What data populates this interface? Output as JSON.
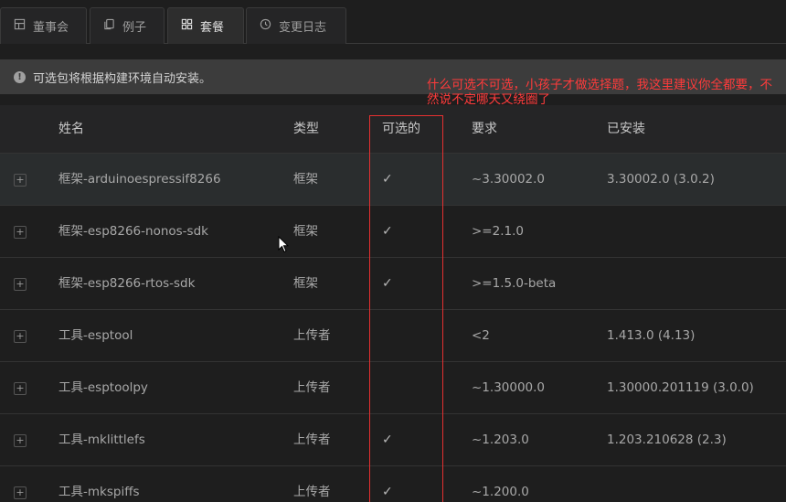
{
  "tabs": [
    {
      "label": "董事会",
      "icon": "dashboard-icon"
    },
    {
      "label": "例子",
      "icon": "copy-icon"
    },
    {
      "label": "套餐",
      "icon": "grid-icon",
      "active": true
    },
    {
      "label": "变更日志",
      "icon": "clock-icon"
    }
  ],
  "notice": {
    "icon": "info-icon",
    "text": "可选包将根据构建环境自动安装。"
  },
  "annotation": {
    "text": "什么可选不可选，小孩子才做选择题，我这里建议你全都要，不然说不定哪天又绕圈了"
  },
  "table": {
    "headers": {
      "name": "姓名",
      "type": "类型",
      "optional": "可选的",
      "requirement": "要求",
      "installed": "已安装"
    },
    "rows": [
      {
        "name": "框架-arduinoespressif8266",
        "type": "框架",
        "optional": "✓",
        "requirement": "~3.30002.0",
        "installed": "3.30002.0 (3.0.2)"
      },
      {
        "name": "框架-esp8266-nonos-sdk",
        "type": "框架",
        "optional": "✓",
        "requirement": ">=2.1.0",
        "installed": ""
      },
      {
        "name": "框架-esp8266-rtos-sdk",
        "type": "框架",
        "optional": "✓",
        "requirement": ">=1.5.0-beta",
        "installed": ""
      },
      {
        "name": "工具-esptool",
        "type": "上传者",
        "optional": "",
        "requirement": "<2",
        "installed": "1.413.0 (4.13)"
      },
      {
        "name": "工具-esptoolpy",
        "type": "上传者",
        "optional": "",
        "requirement": "~1.30000.0",
        "installed": "1.30000.201119 (3.0.0)"
      },
      {
        "name": "工具-mklittlefs",
        "type": "上传者",
        "optional": "✓",
        "requirement": "~1.203.0",
        "installed": "1.203.210628 (2.3)"
      },
      {
        "name": "工具-mkspiffs",
        "type": "上传者",
        "optional": "✓",
        "requirement": "~1.200.0",
        "installed": ""
      }
    ],
    "expand_symbol": "+"
  },
  "colors": {
    "background": "#1e1e1e",
    "annotation": "#ff3b3b",
    "highlight_box": "#e53030"
  }
}
